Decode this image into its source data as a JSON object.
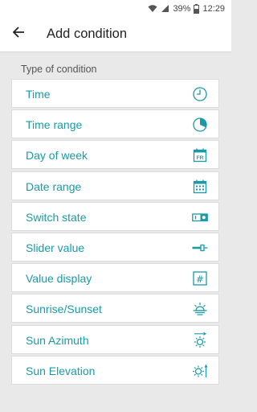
{
  "status_bar": {
    "battery_percent": "39%",
    "time": "12:29"
  },
  "header": {
    "title": "Add condition",
    "back_icon": "arrow-back-icon"
  },
  "section": {
    "label": "Type of condition"
  },
  "conditions": [
    {
      "label": "Time",
      "icon": "clock-icon"
    },
    {
      "label": "Time range",
      "icon": "pie-clock-icon"
    },
    {
      "label": "Day of week",
      "icon": "calendar-fr-icon",
      "icon_text": "FR"
    },
    {
      "label": "Date range",
      "icon": "calendar-grid-icon"
    },
    {
      "label": "Switch state",
      "icon": "switch-icon"
    },
    {
      "label": "Slider value",
      "icon": "slider-icon"
    },
    {
      "label": "Value display",
      "icon": "hash-icon",
      "icon_text": "#"
    },
    {
      "label": "Sunrise/Sunset",
      "icon": "sunrise-icon"
    },
    {
      "label": "Sun Azimuth",
      "icon": "sun-azimuth-icon"
    },
    {
      "label": "Sun Elevation",
      "icon": "sun-elevation-icon"
    }
  ],
  "colors": {
    "accent": "#1a9aa6",
    "background": "#e9e9e9",
    "card": "#ffffff"
  }
}
